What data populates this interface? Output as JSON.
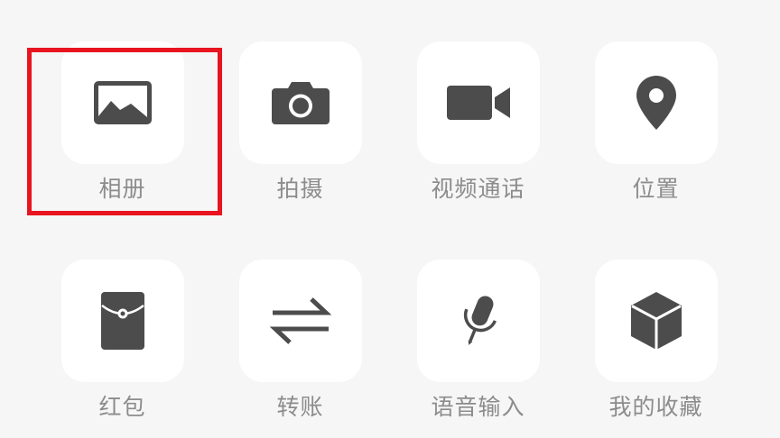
{
  "panel": {
    "items": [
      {
        "label": "相册",
        "icon": "photo-icon",
        "highlighted": true
      },
      {
        "label": "拍摄",
        "icon": "camera-icon",
        "highlighted": false
      },
      {
        "label": "视频通话",
        "icon": "video-camera-icon",
        "highlighted": false
      },
      {
        "label": "位置",
        "icon": "location-pin-icon",
        "highlighted": false
      },
      {
        "label": "红包",
        "icon": "red-packet-icon",
        "highlighted": false
      },
      {
        "label": "转账",
        "icon": "transfer-icon",
        "highlighted": false
      },
      {
        "label": "语音输入",
        "icon": "microphone-icon",
        "highlighted": false
      },
      {
        "label": "我的收藏",
        "icon": "favorites-cube-icon",
        "highlighted": false
      }
    ]
  },
  "highlight": {
    "color": "#e8141f"
  },
  "colors": {
    "background": "#f6f6f6",
    "tile": "#ffffff",
    "icon": "#4c4c4c",
    "label": "#8c8c8c"
  }
}
